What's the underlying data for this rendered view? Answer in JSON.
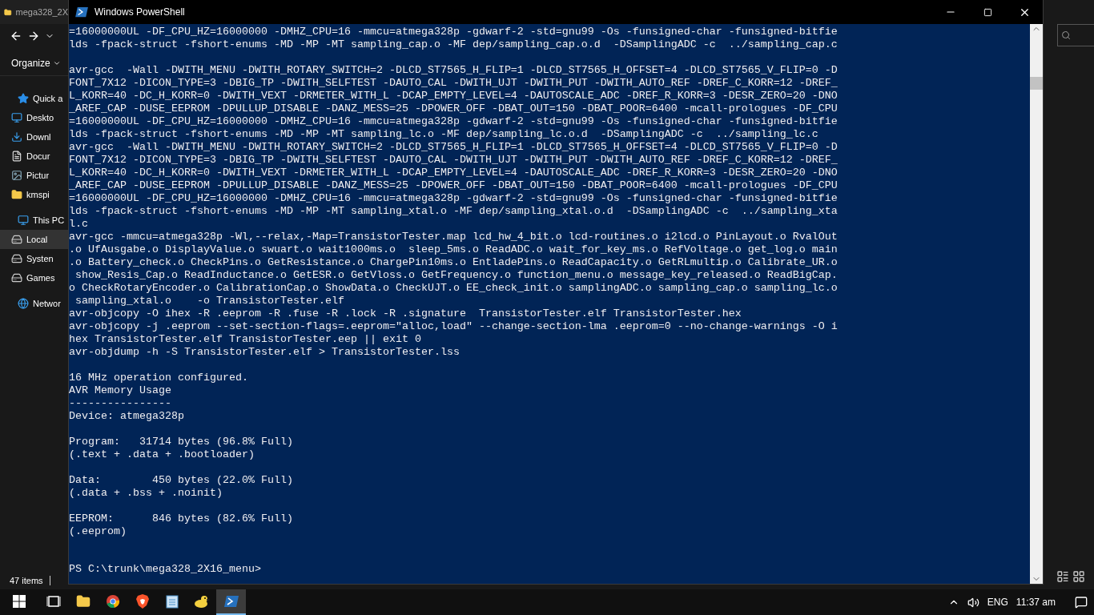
{
  "explorer": {
    "title": "mega328_2X",
    "organize": "Organize",
    "nav_items": [
      {
        "label": "Quick a",
        "kind": "star",
        "selected": false,
        "children": [
          {
            "label": "Deskto",
            "kind": "desktop",
            "selected": false
          },
          {
            "label": "Downl",
            "kind": "download",
            "selected": false
          },
          {
            "label": "Docur",
            "kind": "document",
            "selected": false
          },
          {
            "label": "Pictur",
            "kind": "pictures",
            "selected": false
          },
          {
            "label": "kmspi",
            "kind": "folder",
            "selected": false
          }
        ]
      },
      {
        "label": "This PC",
        "kind": "pc",
        "selected": false,
        "children": [
          {
            "label": "Local",
            "kind": "drive",
            "selected": true
          },
          {
            "label": "Systen",
            "kind": "drive",
            "selected": false
          },
          {
            "label": "Games",
            "kind": "drive",
            "selected": false
          }
        ]
      },
      {
        "label": "Networ",
        "kind": "network",
        "selected": false
      }
    ],
    "status": "47 items"
  },
  "terminal": {
    "title": "Windows PowerShell",
    "blocks": [
      [
        "=16000000UL -DF_CPU_HZ=16000000 -DMHZ_CPU=16 -mmcu=atmega328p -gdwarf-2 -std=gnu99 -Os -funsigned-char -funsigned-bitfie",
        "lds -fpack-struct -fshort-enums -MD -MP -MT sampling_cap.o -MF dep/sampling_cap.o.d  -DSamplingADC -c  ../sampling_cap.c"
      ],
      [
        "avr-gcc  -Wall -DWITH_MENU -DWITH_ROTARY_SWITCH=2 -DLCD_ST7565_H_FLIP=1 -DLCD_ST7565_H_OFFSET=4 -DLCD_ST7565_V_FLIP=0 -D",
        "FONT_7X12 -DICON_TYPE=3 -DBIG_TP -DWITH_SELFTEST -DAUTO_CAL -DWITH_UJT -DWITH_PUT -DWITH_AUTO_REF -DREF_C_KORR=12 -DREF_",
        "L_KORR=40 -DC_H_KORR=0 -DWITH_VEXT -DRMETER_WITH_L -DCAP_EMPTY_LEVEL=4 -DAUTOSCALE_ADC -DREF_R_KORR=3 -DESR_ZERO=20 -DNO",
        "_AREF_CAP -DUSE_EEPROM -DPULLUP_DISABLE -DANZ_MESS=25 -DPOWER_OFF -DBAT_OUT=150 -DBAT_POOR=6400 -mcall-prologues -DF_CPU",
        "=16000000UL -DF_CPU_HZ=16000000 -DMHZ_CPU=16 -mmcu=atmega328p -gdwarf-2 -std=gnu99 -Os -funsigned-char -funsigned-bitfie",
        "lds -fpack-struct -fshort-enums -MD -MP -MT sampling_lc.o -MF dep/sampling_lc.o.d  -DSamplingADC -c  ../sampling_lc.c",
        "avr-gcc  -Wall -DWITH_MENU -DWITH_ROTARY_SWITCH=2 -DLCD_ST7565_H_FLIP=1 -DLCD_ST7565_H_OFFSET=4 -DLCD_ST7565_V_FLIP=0 -D",
        "FONT_7X12 -DICON_TYPE=3 -DBIG_TP -DWITH_SELFTEST -DAUTO_CAL -DWITH_UJT -DWITH_PUT -DWITH_AUTO_REF -DREF_C_KORR=12 -DREF_",
        "L_KORR=40 -DC_H_KORR=0 -DWITH_VEXT -DRMETER_WITH_L -DCAP_EMPTY_LEVEL=4 -DAUTOSCALE_ADC -DREF_R_KORR=3 -DESR_ZERO=20 -DNO",
        "_AREF_CAP -DUSE_EEPROM -DPULLUP_DISABLE -DANZ_MESS=25 -DPOWER_OFF -DBAT_OUT=150 -DBAT_POOR=6400 -mcall-prologues -DF_CPU",
        "=16000000UL -DF_CPU_HZ=16000000 -DMHZ_CPU=16 -mmcu=atmega328p -gdwarf-2 -std=gnu99 -Os -funsigned-char -funsigned-bitfie",
        "lds -fpack-struct -fshort-enums -MD -MP -MT sampling_xtal.o -MF dep/sampling_xtal.o.d  -DSamplingADC -c  ../sampling_xta",
        "l.c",
        "avr-gcc -mmcu=atmega328p -Wl,--relax,-Map=TransistorTester.map lcd_hw_4_bit.o lcd-routines.o i2lcd.o PinLayout.o RvalOut",
        ".o UfAusgabe.o DisplayValue.o swuart.o wait1000ms.o  sleep_5ms.o ReadADC.o wait_for_key_ms.o RefVoltage.o get_log.o main",
        ".o Battery_check.o CheckPins.o GetResistance.o ChargePin10ms.o EntladePins.o ReadCapacity.o GetRLmultip.o Calibrate_UR.o",
        " show_Resis_Cap.o ReadInductance.o GetESR.o GetVloss.o GetFrequency.o function_menu.o message_key_released.o ReadBigCap.",
        "o CheckRotaryEncoder.o CalibrationCap.o ShowData.o CheckUJT.o EE_check_init.o samplingADC.o sampling_cap.o sampling_lc.o",
        " sampling_xtal.o    -o TransistorTester.elf",
        "avr-objcopy -O ihex -R .eeprom -R .fuse -R .lock -R .signature  TransistorTester.elf TransistorTester.hex",
        "avr-objcopy -j .eeprom --set-section-flags=.eeprom=\"alloc,load\" --change-section-lma .eeprom=0 --no-change-warnings -O i",
        "hex TransistorTester.elf TransistorTester.eep || exit 0",
        "avr-objdump -h -S TransistorTester.elf > TransistorTester.lss"
      ],
      [
        "16 MHz operation configured.",
        "AVR Memory Usage",
        "----------------",
        "Device: atmega328p"
      ],
      [
        "Program:   31714 bytes (96.8% Full)",
        "(.text + .data + .bootloader)"
      ],
      [
        "Data:        450 bytes (22.0% Full)",
        "(.data + .bss + .noinit)"
      ],
      [
        "EEPROM:      846 bytes (82.6% Full)",
        "(.eeprom)"
      ]
    ],
    "prompt": "PS C:\\trunk\\mega328_2X16_menu>"
  },
  "taskbar": {
    "apps": [
      {
        "kind": "taskview",
        "selected": false
      },
      {
        "kind": "explorer",
        "selected": false
      },
      {
        "kind": "chrome",
        "selected": false
      },
      {
        "kind": "brave",
        "selected": false
      },
      {
        "kind": "notepad",
        "selected": false
      },
      {
        "kind": "duck",
        "selected": false
      },
      {
        "kind": "powershell",
        "selected": true
      }
    ],
    "language": "ENG",
    "time": "11:37 am"
  }
}
